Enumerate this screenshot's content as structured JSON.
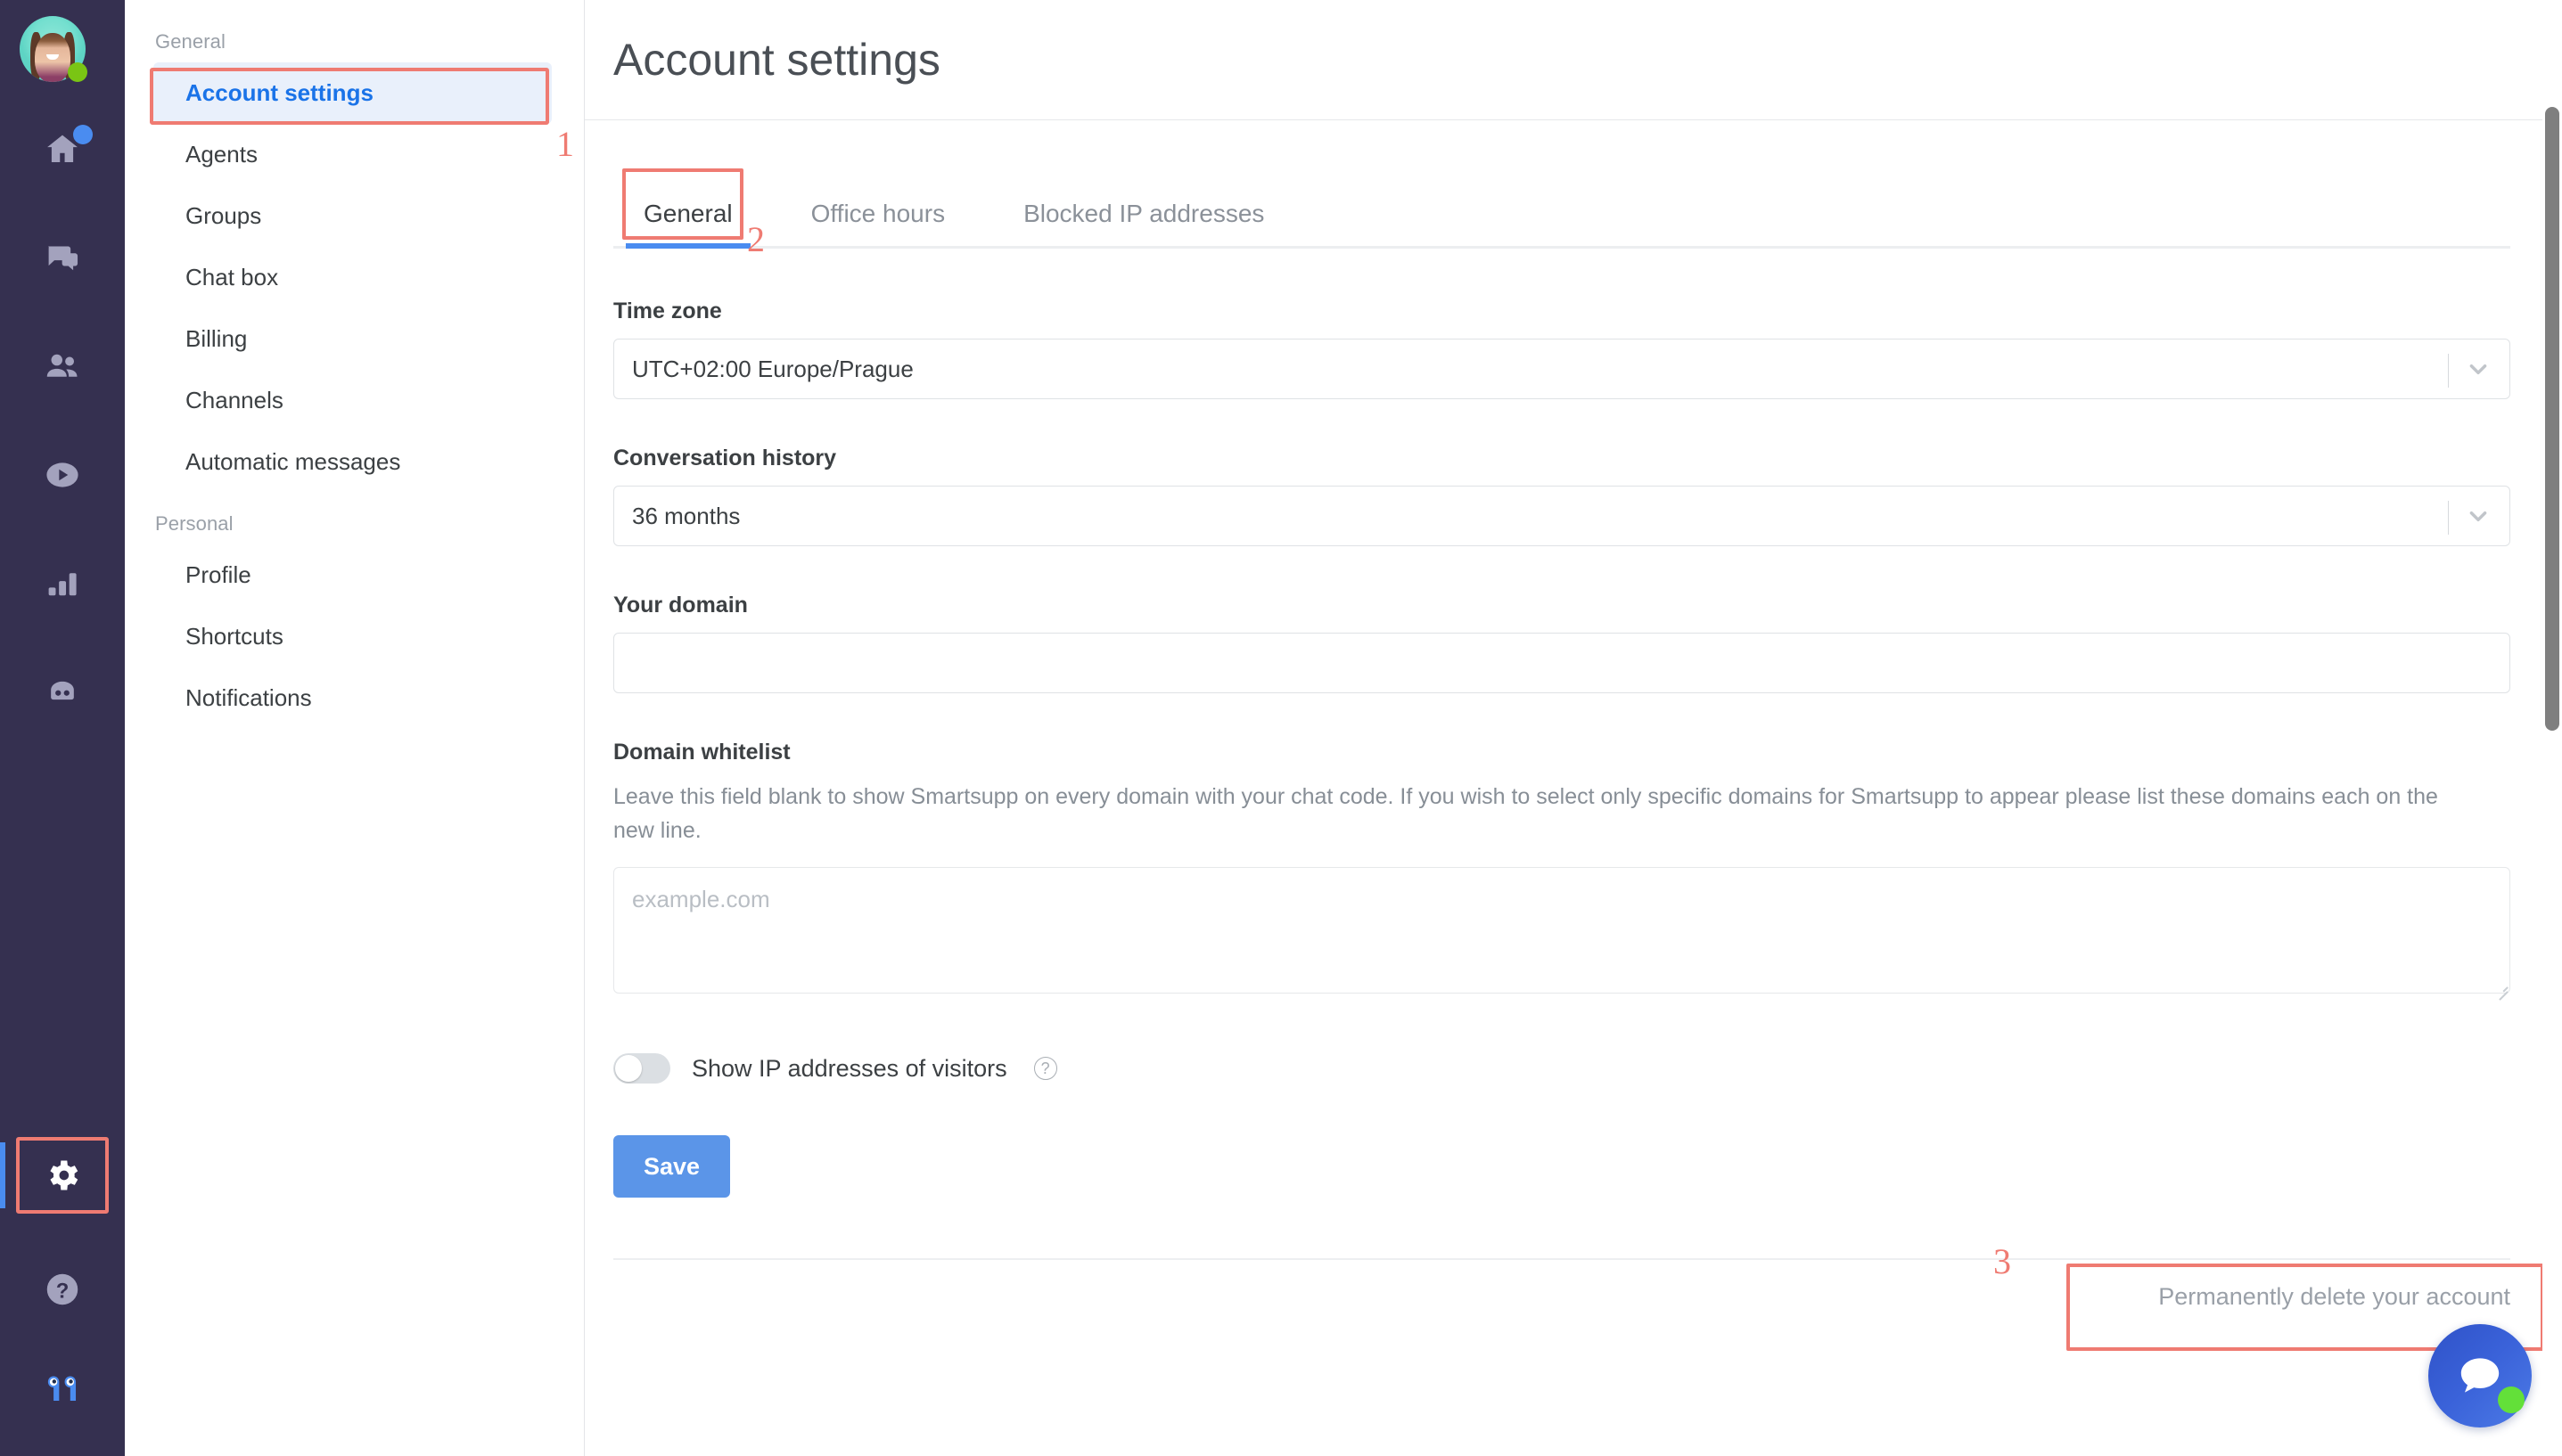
{
  "rail": {
    "avatar_name": "user-avatar",
    "status": "online",
    "items": [
      {
        "name": "home",
        "badge": true
      },
      {
        "name": "conversations",
        "badge": false
      },
      {
        "name": "visitors",
        "badge": false
      },
      {
        "name": "video",
        "badge": false
      },
      {
        "name": "statistics",
        "badge": false
      },
      {
        "name": "chatbot",
        "badge": false
      },
      {
        "name": "settings",
        "badge": false
      },
      {
        "name": "help",
        "badge": false
      },
      {
        "name": "logo",
        "badge": false
      }
    ]
  },
  "nav": {
    "sections": [
      {
        "title": "General",
        "items": [
          {
            "label": "Account settings",
            "active": true
          },
          {
            "label": "Agents",
            "active": false
          },
          {
            "label": "Groups",
            "active": false
          },
          {
            "label": "Chat box",
            "active": false
          },
          {
            "label": "Billing",
            "active": false
          },
          {
            "label": "Channels",
            "active": false
          },
          {
            "label": "Automatic messages",
            "active": false
          }
        ]
      },
      {
        "title": "Personal",
        "items": [
          {
            "label": "Profile",
            "active": false
          },
          {
            "label": "Shortcuts",
            "active": false
          },
          {
            "label": "Notifications",
            "active": false
          }
        ]
      }
    ]
  },
  "header": {
    "title": "Account settings"
  },
  "tabs": [
    {
      "label": "General",
      "active": true
    },
    {
      "label": "Office hours",
      "active": false
    },
    {
      "label": "Blocked IP addresses",
      "active": false
    }
  ],
  "form": {
    "timezone": {
      "label": "Time zone",
      "value": "UTC+02:00 Europe/Prague"
    },
    "conversation_history": {
      "label": "Conversation history",
      "value": "36 months"
    },
    "your_domain": {
      "label": "Your domain",
      "value": "",
      "placeholder": ""
    },
    "domain_whitelist": {
      "label": "Domain whitelist",
      "help": "Leave this field blank to show Smartsupp on every domain with your chat code. If you wish to select only specific domains for Smartsupp to appear please list these domains each on the new line.",
      "value": "",
      "placeholder": "example.com"
    },
    "show_ip_toggle": {
      "label": "Show IP addresses of visitors",
      "state": "off",
      "help_glyph": "?"
    },
    "save_label": "Save",
    "delete_account_label": "Permanently delete your account"
  },
  "annotations": [
    {
      "number": "1",
      "target": "nav-account-settings"
    },
    {
      "number": "2",
      "target": "tab-general"
    },
    {
      "number": "3",
      "target": "delete-account-link"
    }
  ],
  "colors": {
    "rail_bg": "#353050",
    "accent_blue": "#4a8cf0",
    "active_nav_bg": "#e9f0fb",
    "active_nav_text": "#1a73e8",
    "annotation_red": "#ef7b72",
    "save_button": "#5b95e8",
    "online_green": "#7ac514",
    "chat_widget_blue": "#3a62d9"
  }
}
